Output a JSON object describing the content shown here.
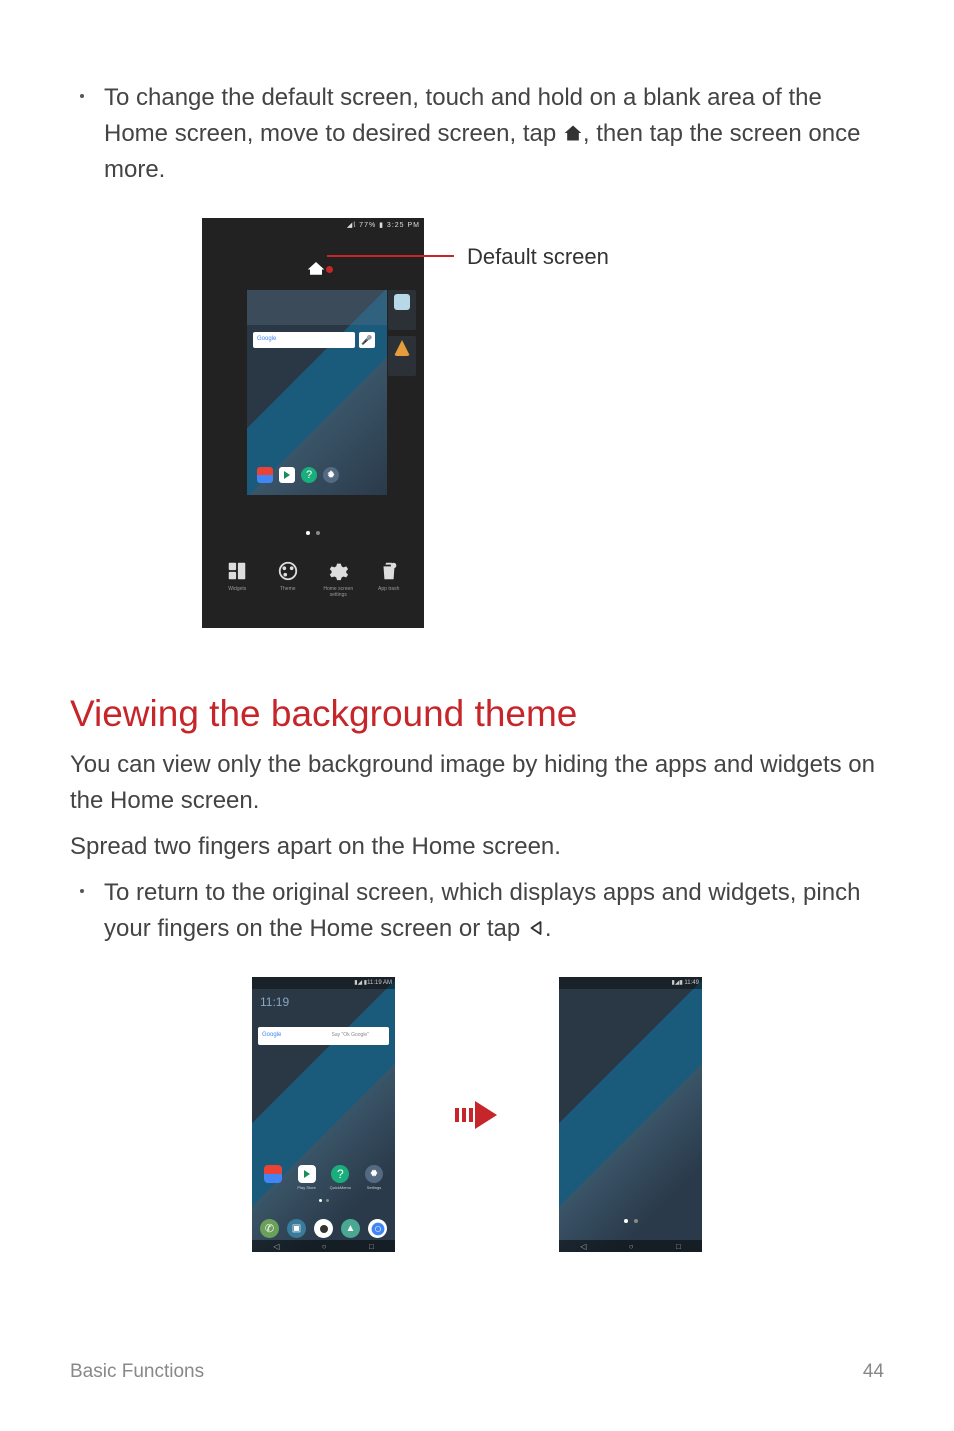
{
  "bullet1": {
    "part1": "To change the default screen, touch and hold on a blank area of the Home screen, move to desired screen, tap ",
    "part2": ", then tap the screen once more."
  },
  "figure1": {
    "statusbar": "◢𝗅 77% ▮ 3:25 PM",
    "callout": "Default screen",
    "google": "Google",
    "toolbar": {
      "widgets": "Widgets",
      "theme": "Theme",
      "homesettings": "Home screen settings",
      "apptrash": "App trash"
    }
  },
  "section": {
    "heading": "Viewing the background theme",
    "p1": "You can view only the background image by hiding the apps and widgets on the Home screen.",
    "p2": "Spread two fingers apart on the Home screen."
  },
  "bullet2": {
    "part1": "To return to the original screen, which displays apps and widgets, pinch your fingers on the Home screen or tap ",
    "part2": "."
  },
  "figure2": {
    "left": {
      "statusbar": "▮◢ ▮11:19 AM",
      "clock": "11:19",
      "google": "Google",
      "google_hint": "Say \"Ok Google\"",
      "apps": [
        "",
        "Play Store",
        "QuickMemo",
        "Settings"
      ]
    },
    "right": {
      "statusbar": "▮◢▮ 11:49"
    }
  },
  "footer": {
    "left": "Basic Functions",
    "right": "44"
  },
  "colors": {
    "accent": "#c6262a"
  }
}
